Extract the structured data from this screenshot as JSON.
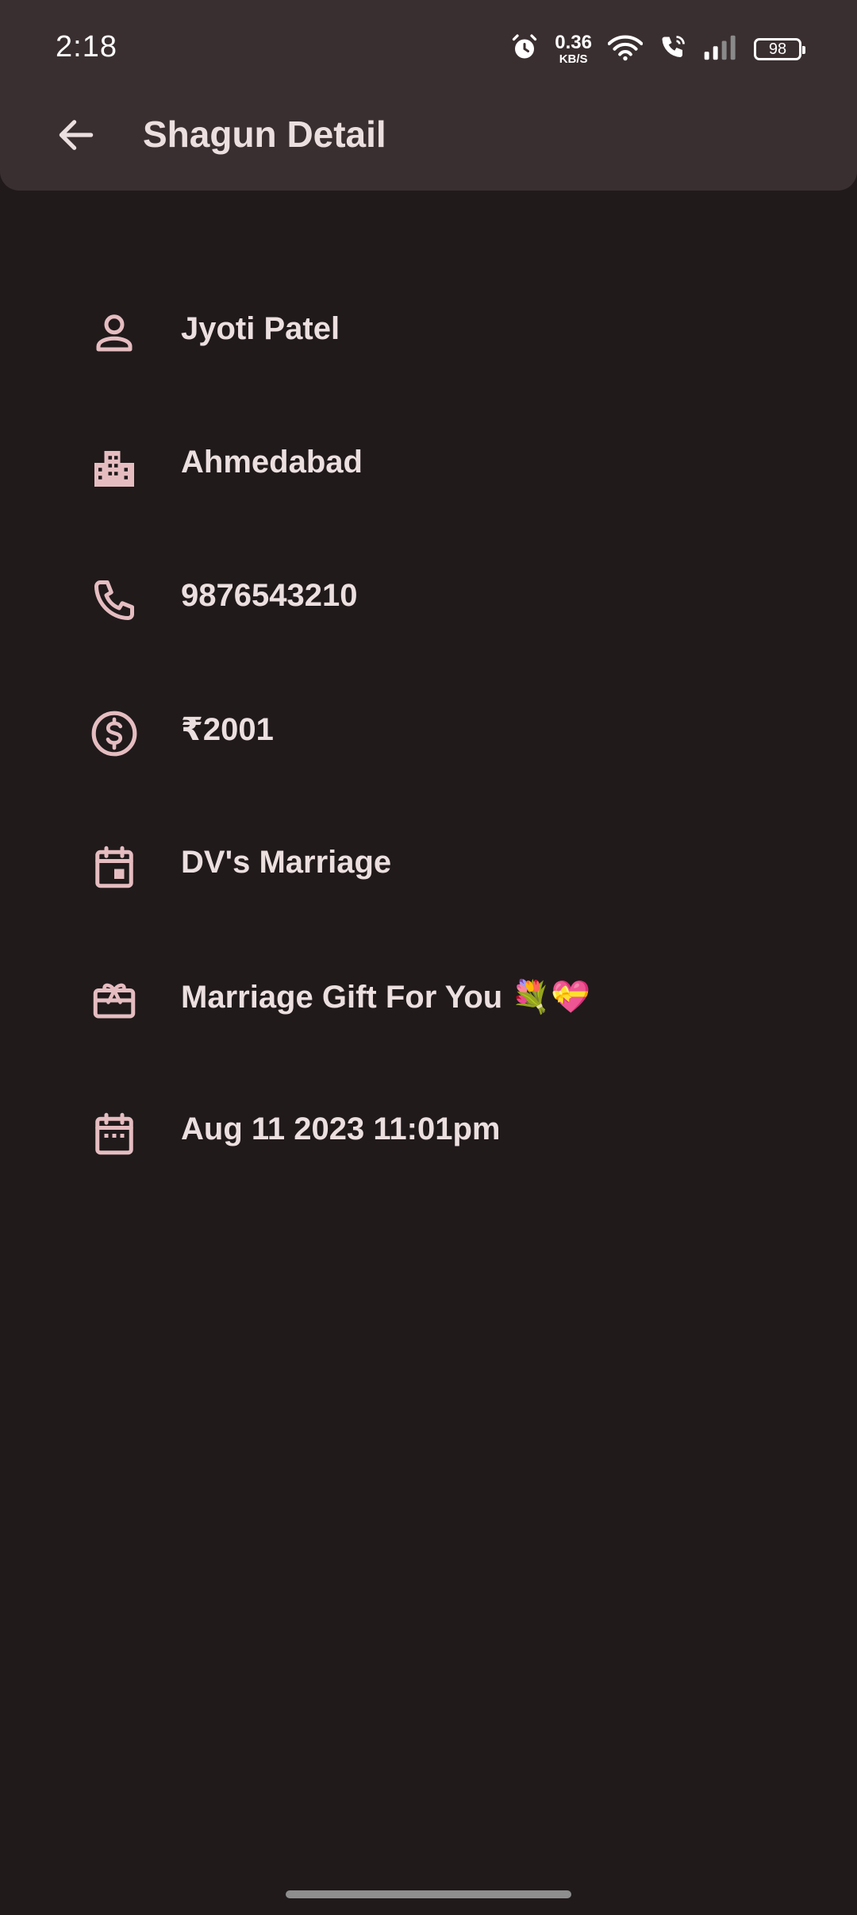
{
  "status_bar": {
    "time": "2:18",
    "net_speed_value": "0.36",
    "net_speed_unit": "KB/S",
    "battery": "98"
  },
  "toolbar": {
    "title": "Shagun Detail",
    "back_icon": "arrow-back-icon"
  },
  "details": [
    {
      "icon": "person-icon",
      "label": "Jyoti Patel"
    },
    {
      "icon": "city-icon",
      "label": "Ahmedabad"
    },
    {
      "icon": "phone-icon",
      "label": "9876543210"
    },
    {
      "icon": "currency-icon",
      "label": "₹2001"
    },
    {
      "icon": "event-icon",
      "label": "DV's Marriage"
    },
    {
      "icon": "gift-card-icon",
      "label": "Marriage Gift For You 💐💝"
    },
    {
      "icon": "calendar-icon",
      "label": "Aug 11 2023 11:01pm"
    }
  ],
  "colors": {
    "background": "#201a1b",
    "app_bar": "#3a2f30",
    "text": "#ecdfe0",
    "icon": "#e5bdc1"
  }
}
